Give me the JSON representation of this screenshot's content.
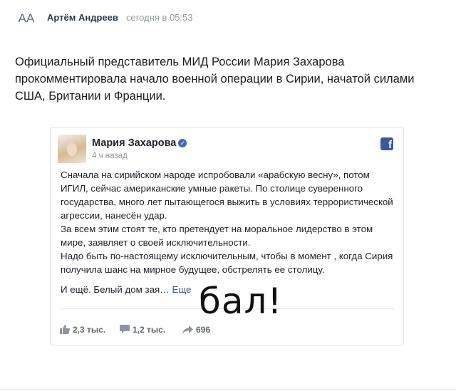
{
  "post": {
    "avatar_initials": "AA",
    "author": "Артём Андреев",
    "time": "сегодня в 05:53",
    "text": "Официальный представитель МИД России Мария Захарова прокомментировала начало военной операции в Сирии, начатой силами США, Британии и Франции."
  },
  "embed": {
    "name": "Мария Захарова",
    "time": "4 ч назад",
    "paragraphs": [
      "Сначала на сирийском народе испробовали «арабскую весну», потом ИГИЛ, сейчас американские умные ракеты. По столице суверенного государства, много лет пытающегося выжить в условиях террористической агрессии, нанесён удар.",
      "За всем этим стоят те, кто претендует на моральное лидерство в этом мире, заявляет о своей исключительности.",
      "Надо быть по-настоящему исключительным, чтобы в момент , когда Сирия получила шанс на мирное будущее, обстрелять ее столицу."
    ],
    "last_line": "И ещё. Белый дом зая…",
    "more_label": "Еще",
    "likes": "2,3 тыс.",
    "comments": "1,2 тыс.",
    "shares": "696"
  },
  "overlay_text": "бал!"
}
